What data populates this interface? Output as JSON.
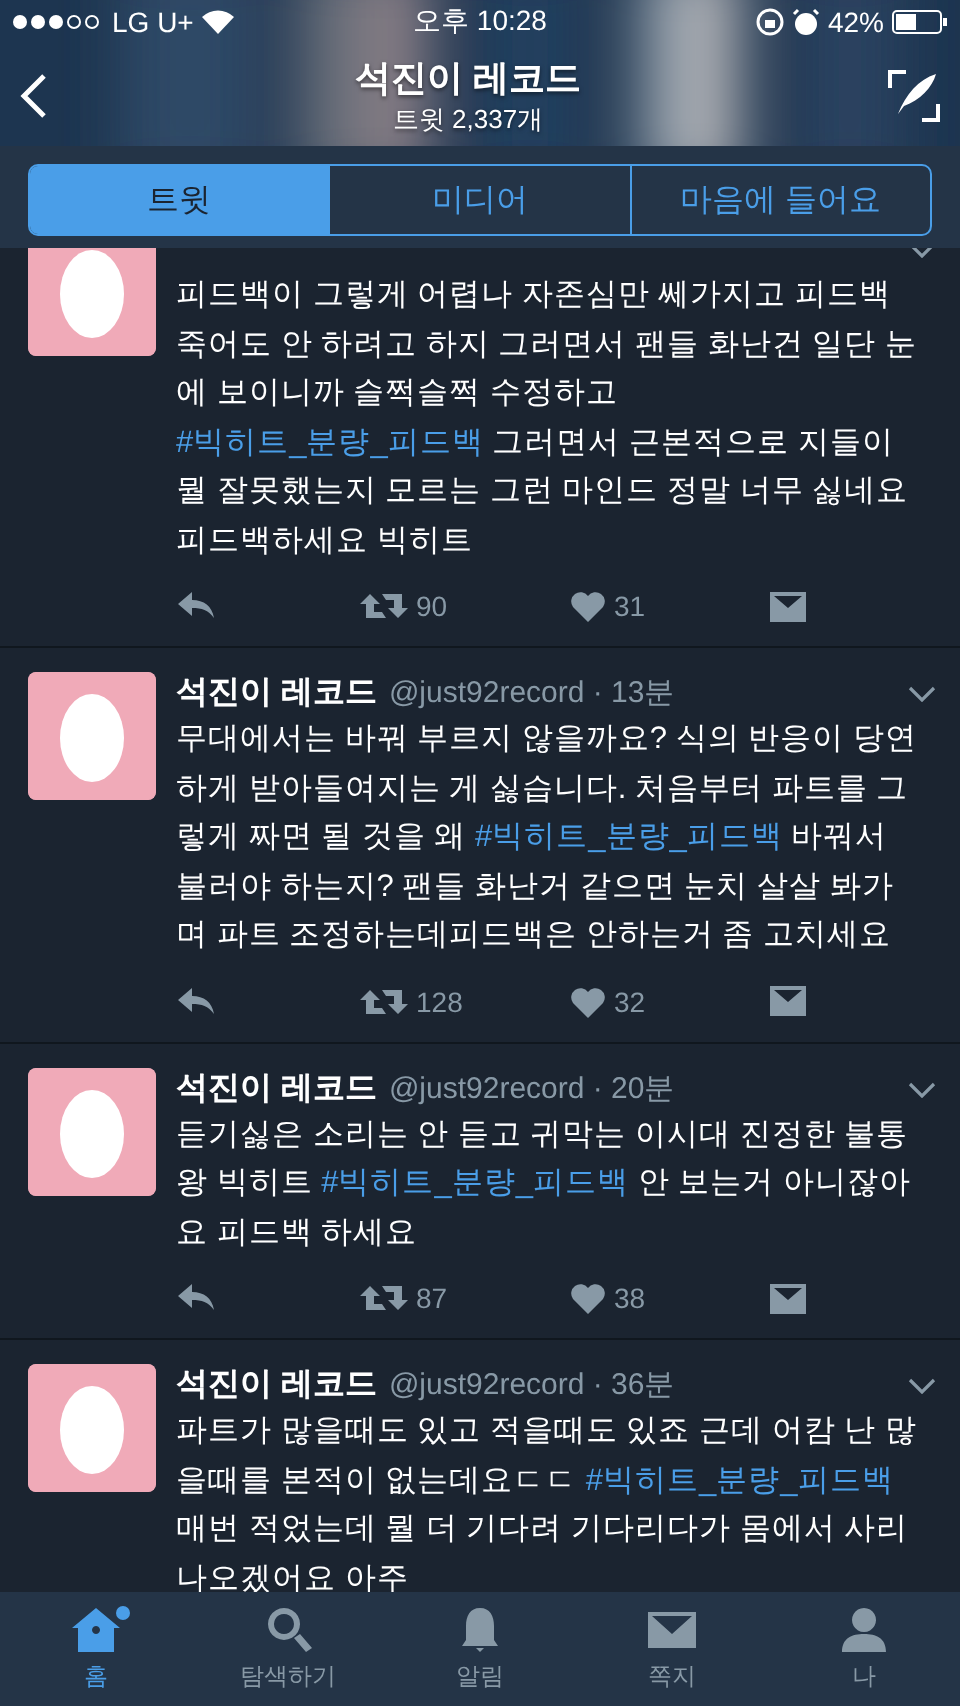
{
  "status_bar": {
    "carrier": "LG U+",
    "time": "오후 10:28",
    "battery": "42%"
  },
  "profile_header": {
    "title": "석진이 레코드",
    "subtitle": "트윗 2,337개"
  },
  "tabs": [
    {
      "label": "트윗",
      "selected": true
    },
    {
      "label": "미디어",
      "selected": false
    },
    {
      "label": "마음에 들어요",
      "selected": false
    }
  ],
  "tweets": [
    {
      "text": [
        {
          "kind": "text",
          "text": "피드백이 그렇게 어렵나 자존심만 쎄가지고 피드백 죽어도 안 하려고 하지 그러면서 팬들 화난건 일단 눈에 보이니까 슬쩍슬쩍 수정하고 "
        },
        {
          "kind": "hashtag",
          "text": "#빅히트_분량_피드백"
        },
        {
          "kind": "text",
          "text": " 그러면서 근본적으로 지들이 뭘 잘못했는지 모르는 그런 마인드 정말 너무 싫네요 피드백하세요 빅히트"
        }
      ],
      "retweets": "90",
      "likes": "31"
    },
    {
      "name": "석진이 레코드",
      "meta": "@just92record · 13분",
      "text": [
        {
          "kind": "text",
          "text": "무대에서는 바꿔 부르지 않을까요? 식의 반응이 당연하게 받아들여지는 게 싫습니다. 처음부터 파트를 그렇게 짜면 될 것을 왜 "
        },
        {
          "kind": "hashtag",
          "text": "#빅히트_분량_피드백"
        },
        {
          "kind": "text",
          "text": " 바꿔서 불러야 하는지? 팬들 화난거 같으면 눈치 살살 봐가며 파트 조정하는데피드백은 안하는거 좀 고치세요"
        }
      ],
      "retweets": "128",
      "likes": "32"
    },
    {
      "name": "석진이 레코드",
      "meta": "@just92record · 20분",
      "text": [
        {
          "kind": "text",
          "text": "듣기싫은 소리는 안 듣고 귀막는 이시대 진정한 불통왕 빅히트 "
        },
        {
          "kind": "hashtag",
          "text": "#빅히트_분량_피드백"
        },
        {
          "kind": "text",
          "text": " 안 보는거 아니잖아요 피드백 하세요"
        }
      ],
      "retweets": "87",
      "likes": "38"
    },
    {
      "name": "석진이 레코드",
      "meta": "@just92record · 36분",
      "text": [
        {
          "kind": "text",
          "text": "파트가 많을때도 있고 적을때도 있죠 근데 어캄 난 많을때를 본적이 없는데요ㄷㄷ "
        },
        {
          "kind": "hashtag",
          "text": "#빅히트_분량_피드백"
        },
        {
          "kind": "text",
          "text": " 매번 적었는데 뭘 더 기다려 기다리다가 몸에서 사리 나오겠어요 아주"
        }
      ]
    }
  ],
  "bottom_nav": [
    {
      "kind": "home",
      "label": "홈",
      "selected": true,
      "dot": true
    },
    {
      "kind": "search",
      "label": "탐색하기",
      "selected": false,
      "dot": false
    },
    {
      "kind": "bell",
      "label": "알림",
      "selected": false,
      "dot": false
    },
    {
      "kind": "mail",
      "label": "쪽지",
      "selected": false,
      "dot": false
    },
    {
      "kind": "person",
      "label": "나",
      "selected": false,
      "dot": false
    }
  ]
}
